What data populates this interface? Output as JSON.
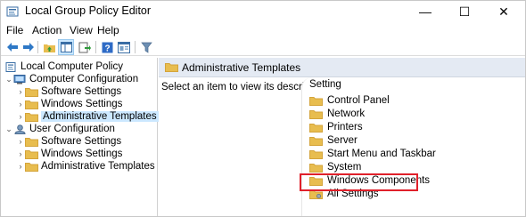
{
  "window": {
    "title": "Local Group Policy Editor",
    "controls": {
      "minimize": "—",
      "maximize": "☐",
      "close": "✕"
    }
  },
  "menu": [
    "File",
    "Action",
    "View",
    "Help"
  ],
  "toolbar": {
    "icons": [
      "back-arrow-icon",
      "forward-arrow-icon",
      "up-folder-icon",
      "show-hide-tree-icon",
      "export-list-icon",
      "help-icon",
      "properties-icon",
      "filter-icon"
    ]
  },
  "tree": {
    "root": "Local Computer Policy",
    "computer": {
      "label": "Computer Configuration",
      "children": [
        "Software Settings",
        "Windows Settings",
        "Administrative Templates"
      ]
    },
    "user": {
      "label": "User Configuration",
      "children": [
        "Software Settings",
        "Windows Settings",
        "Administrative Templates"
      ]
    },
    "selected": "Administrative Templates"
  },
  "right": {
    "header": "Administrative Templates",
    "description": "Select an item to view its description.",
    "column_header": "Setting",
    "items": [
      "Control Panel",
      "Network",
      "Printers",
      "Server",
      "Start Menu and Taskbar",
      "System",
      "Windows Components",
      "All Settings"
    ],
    "highlighted": "Windows Components"
  },
  "colors": {
    "folder": "#e8bd4f",
    "folder_dark": "#d4a43a",
    "selection": "#cce8ff",
    "highlight_border": "#e0202a",
    "header_bg": "#e4eaf3"
  }
}
